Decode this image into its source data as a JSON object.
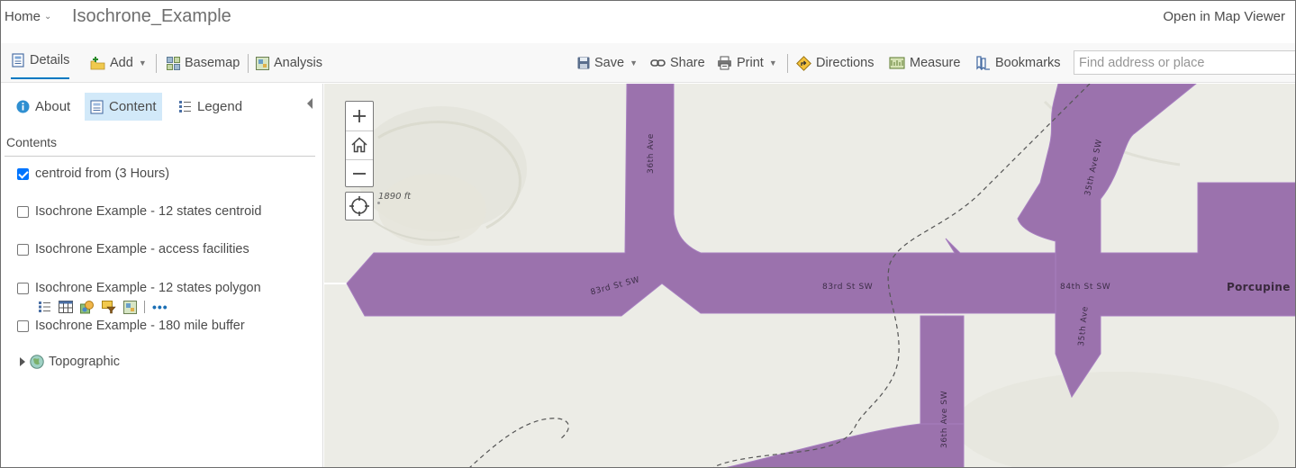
{
  "header": {
    "home_label": "Home",
    "map_title": "Isochrone_Example",
    "open_map_viewer": "Open in Map Viewer"
  },
  "toolbar": {
    "details": "Details",
    "add": "Add",
    "basemap": "Basemap",
    "analysis": "Analysis",
    "save": "Save",
    "share": "Share",
    "print": "Print",
    "directions": "Directions",
    "measure": "Measure",
    "bookmarks": "Bookmarks",
    "search_placeholder": "Find address or place"
  },
  "panel": {
    "tabs": {
      "about": "About",
      "content": "Content",
      "legend": "Legend"
    },
    "contents_label": "Contents",
    "layers": [
      {
        "name": "centroid from (3 Hours)",
        "checked": true
      },
      {
        "name": "Isochrone Example - 12 states centroid",
        "checked": false
      },
      {
        "name": "Isochrone Example - access facilities",
        "checked": false
      },
      {
        "name": "Isochrone Example - 12 states polygon",
        "checked": false
      },
      {
        "name": "Isochrone Example - 180 mile buffer",
        "checked": false
      }
    ],
    "basemap_layer": "Topographic"
  },
  "map": {
    "elevation_label": "1890 ft",
    "zoom_in": "+",
    "zoom_out": "−",
    "road_labels": {
      "ave36_top": "36th Ave",
      "ave36_bottom": "36th Ave SW",
      "st83_left": "83rd St SW",
      "st83_mid": "83rd St SW",
      "st84": "84th St SW",
      "ave35_top": "35th Ave SW",
      "ave35_mid": "35th Ave"
    },
    "place_label": "Porcupine",
    "colors": {
      "isochrone_fill": "#9b72ad",
      "map_background": "#ecece6",
      "trail": "#555555"
    }
  },
  "colors": {
    "accent": "#0079c1",
    "active_tab": "#d2e9f9"
  }
}
